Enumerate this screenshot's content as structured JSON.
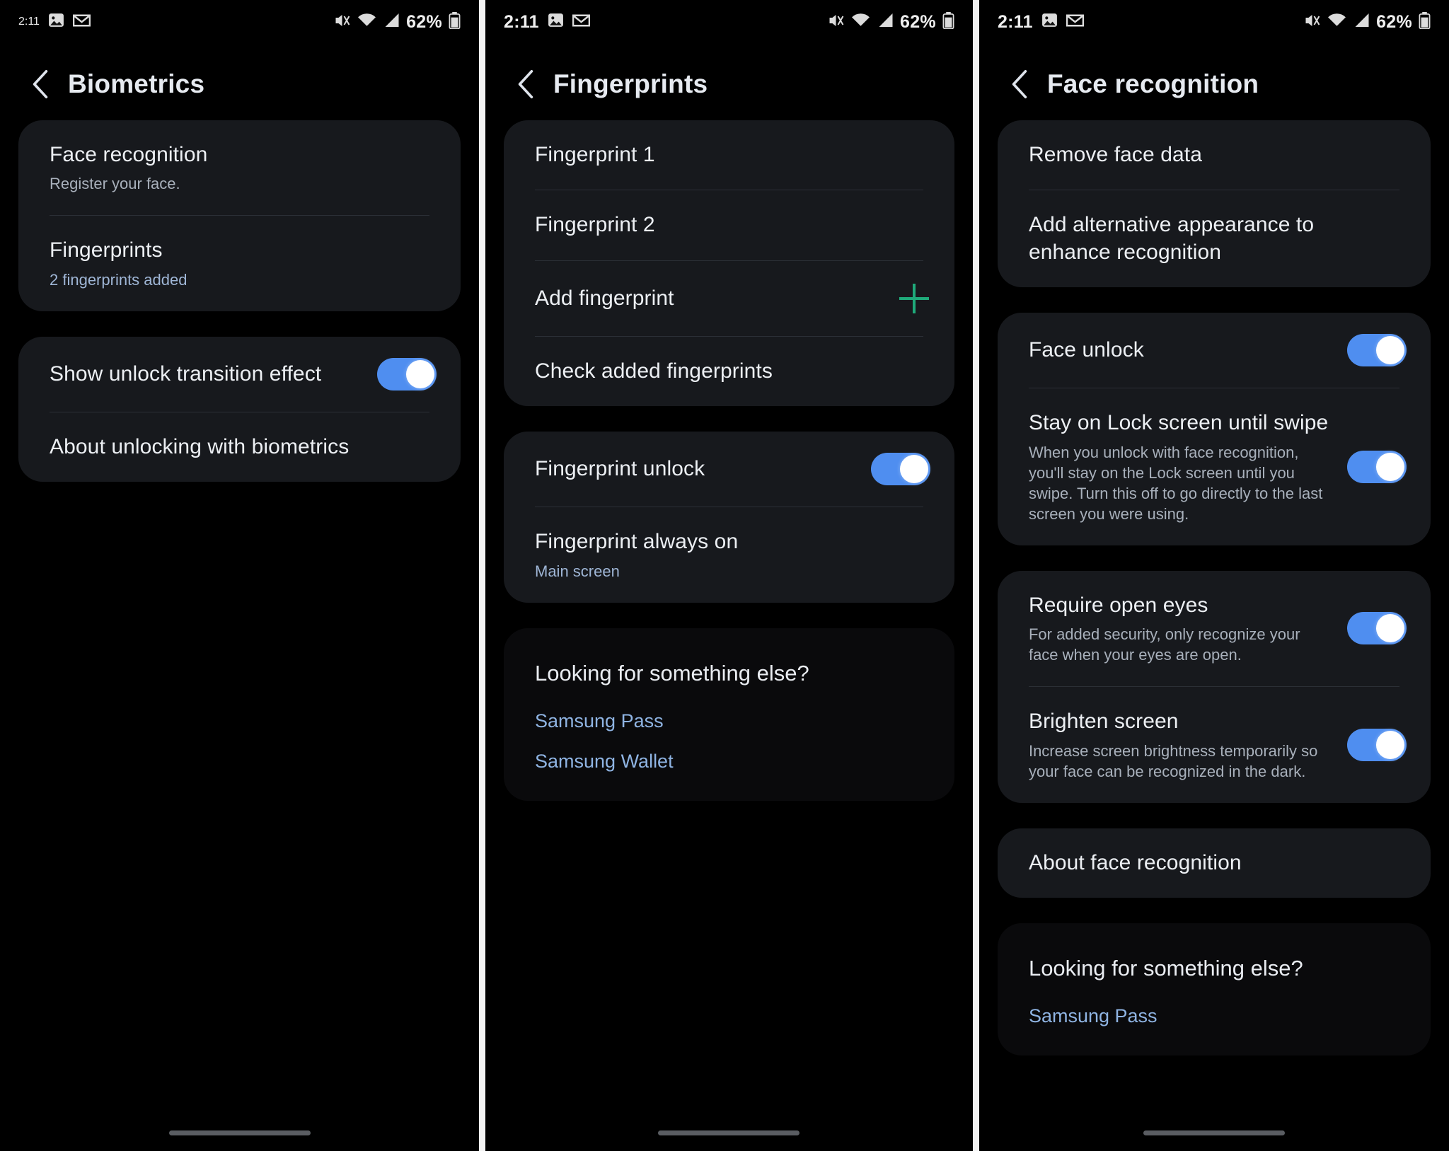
{
  "status_bar": {
    "time": "2:11",
    "left_icons": [
      "photo-icon",
      "gmail-icon"
    ],
    "right_icons": [
      "mute-icon",
      "wifi-icon",
      "signal-icon",
      "battery-icon"
    ],
    "battery": "62%"
  },
  "colors": {
    "toggle_on": "#4f8ef0",
    "accent_green": "#1faa7a",
    "link_blue": "#8fb4e3",
    "card_bg": "#17191d",
    "screen_bg": "#000000"
  },
  "panels": [
    {
      "id": "biometrics",
      "title": "Biometrics",
      "back_icon": "chevron-left-icon",
      "groups": [
        {
          "rows": [
            {
              "title": "Face recognition",
              "sub": "Register your face.",
              "control": "none"
            },
            {
              "title": "Fingerprints",
              "sub": "2 fingerprints added",
              "sub_style": "blue",
              "control": "none"
            }
          ]
        },
        {
          "rows": [
            {
              "title": "Show unlock transition effect",
              "control": "toggle",
              "toggle_on": true
            },
            {
              "title": "About unlocking with biometrics",
              "control": "none"
            }
          ]
        }
      ]
    },
    {
      "id": "fingerprints",
      "title": "Fingerprints",
      "back_icon": "chevron-left-icon",
      "groups": [
        {
          "rows": [
            {
              "title": "Fingerprint 1",
              "control": "none"
            },
            {
              "title": "Fingerprint 2",
              "control": "none"
            },
            {
              "title": "Add fingerprint",
              "control": "plus",
              "plus_icon": "plus-icon"
            },
            {
              "title": "Check added fingerprints",
              "control": "none"
            }
          ]
        },
        {
          "rows": [
            {
              "title": "Fingerprint unlock",
              "control": "toggle",
              "toggle_on": true
            },
            {
              "title": "Fingerprint always on",
              "sub": "Main screen",
              "sub_style": "blue",
              "control": "none"
            }
          ]
        }
      ],
      "looking_for": {
        "title": "Looking for something else?",
        "links": [
          "Samsung Pass",
          "Samsung Wallet"
        ]
      }
    },
    {
      "id": "face-recognition",
      "title": "Face recognition",
      "back_icon": "chevron-left-icon",
      "groups": [
        {
          "rows": [
            {
              "title": "Remove face data",
              "control": "none"
            },
            {
              "title": "Add alternative appearance to enhance recognition",
              "control": "none"
            }
          ]
        },
        {
          "rows": [
            {
              "title": "Face unlock",
              "control": "toggle",
              "toggle_on": true
            },
            {
              "title": "Stay on Lock screen until swipe",
              "sub": "When you unlock with face recognition, you'll stay on the Lock screen until you swipe. Turn this off to go directly to the last screen you were using.",
              "control": "toggle",
              "toggle_on": true
            }
          ]
        },
        {
          "rows": [
            {
              "title": "Require open eyes",
              "sub": "For added security, only recognize your face when your eyes are open.",
              "control": "toggle",
              "toggle_on": true
            },
            {
              "title": "Brighten screen",
              "sub": "Increase screen brightness temporarily so your face can be recognized in the dark.",
              "control": "toggle",
              "toggle_on": true
            }
          ]
        },
        {
          "rows": [
            {
              "title": "About face recognition",
              "control": "none"
            }
          ]
        }
      ],
      "looking_for": {
        "title": "Looking for something else?",
        "links": [
          "Samsung Pass"
        ]
      }
    }
  ]
}
